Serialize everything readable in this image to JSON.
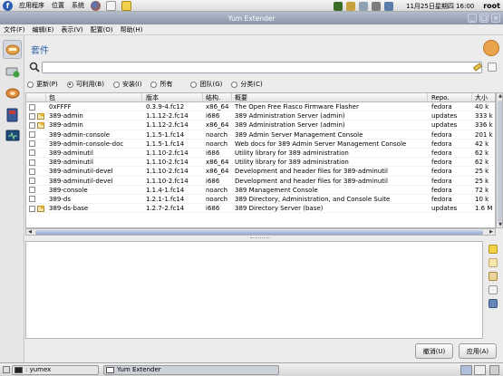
{
  "top_panel": {
    "menus": [
      "应用程序",
      "位置",
      "系统"
    ],
    "clock": "11月25日星期四 16:00",
    "user": "root"
  },
  "window": {
    "title": "Yum Extender"
  },
  "menubar": [
    "文件(F)",
    "编辑(E)",
    "表示(V)",
    "配置(O)",
    "帮助(H)"
  ],
  "page": {
    "title": "套件"
  },
  "search": {
    "value": "",
    "placeholder": ""
  },
  "filters": [
    {
      "label": "更新(P)",
      "selected": false
    },
    {
      "label": "可利用(B)",
      "selected": true
    },
    {
      "label": "安装(I)",
      "selected": false
    },
    {
      "label": "所有",
      "selected": false
    },
    {
      "label": "团队(G)",
      "selected": false
    },
    {
      "label": "分类(C)",
      "selected": false
    }
  ],
  "table": {
    "headers": {
      "name": "包",
      "version": "版本",
      "arch": "结构.",
      "summary": "概要",
      "repo": "Repo.",
      "size": "大小"
    },
    "rows": [
      {
        "name": "0xFFFF",
        "version": "0.3.9-4.fc12",
        "arch": "x86_64",
        "summary": "The Open Free Fiasco Firmware Flasher",
        "repo": "fedora",
        "size": "40 k",
        "icon": "package-icon"
      },
      {
        "name": "389-admin",
        "version": "1.1.12-2.fc14",
        "arch": "i686",
        "summary": "389 Administration Server (admin)",
        "repo": "updates",
        "size": "333 k",
        "icon": "update-package-icon"
      },
      {
        "name": "389-admin",
        "version": "1.1.12-2.fc14",
        "arch": "x86_64",
        "summary": "389 Administration Server (admin)",
        "repo": "updates",
        "size": "336 k",
        "icon": "update-package-icon"
      },
      {
        "name": "389-admin-console",
        "version": "1.1.5-1.fc14",
        "arch": "noarch",
        "summary": "389 Admin Server Management Console",
        "repo": "fedora",
        "size": "201 k",
        "icon": "package-icon"
      },
      {
        "name": "389-admin-console-doc",
        "version": "1.1.5-1.fc14",
        "arch": "noarch",
        "summary": "Web docs for 389 Admin Server Management Console",
        "repo": "fedora",
        "size": "42 k",
        "icon": "package-icon"
      },
      {
        "name": "389-adminutil",
        "version": "1.1.10-2.fc14",
        "arch": "i686",
        "summary": "Utility library for 389 administration",
        "repo": "fedora",
        "size": "62 k",
        "icon": "package-icon"
      },
      {
        "name": "389-adminutil",
        "version": "1.1.10-2.fc14",
        "arch": "x86_64",
        "summary": "Utility library for 389 administration",
        "repo": "fedora",
        "size": "62 k",
        "icon": "package-icon"
      },
      {
        "name": "389-adminutil-devel",
        "version": "1.1.10-2.fc14",
        "arch": "x86_64",
        "summary": "Development and header files for 389-adminutil",
        "repo": "fedora",
        "size": "25 k",
        "icon": "package-icon"
      },
      {
        "name": "389-adminutil-devel",
        "version": "1.1.10-2.fc14",
        "arch": "i686",
        "summary": "Development and header files for 389-adminutil",
        "repo": "fedora",
        "size": "25 k",
        "icon": "package-icon"
      },
      {
        "name": "389-console",
        "version": "1.1.4-1.fc14",
        "arch": "noarch",
        "summary": "389 Management Console",
        "repo": "fedora",
        "size": "72 k",
        "icon": "package-icon"
      },
      {
        "name": "389-ds",
        "version": "1.2.1-1.fc14",
        "arch": "noarch",
        "summary": "389 Directory, Administration, and Console Suite",
        "repo": "fedora",
        "size": "10 k",
        "icon": "package-icon"
      },
      {
        "name": "389-ds-base",
        "version": "1.2.7-2.fc14",
        "arch": "i686",
        "summary": "389 Directory Server (base)",
        "repo": "updates",
        "size": "1.6 M",
        "icon": "update-package-icon"
      }
    ]
  },
  "buttons": {
    "cancel": "撤消(U)",
    "apply": "应用(A)"
  },
  "taskbar": [
    {
      "label": ": yumex",
      "active": false
    },
    {
      "label": "Yum Extender",
      "active": true
    }
  ],
  "colors": {
    "accent": "#2f5fa8",
    "titlebar": "#8895a9",
    "selection": "#c4cbd6"
  }
}
